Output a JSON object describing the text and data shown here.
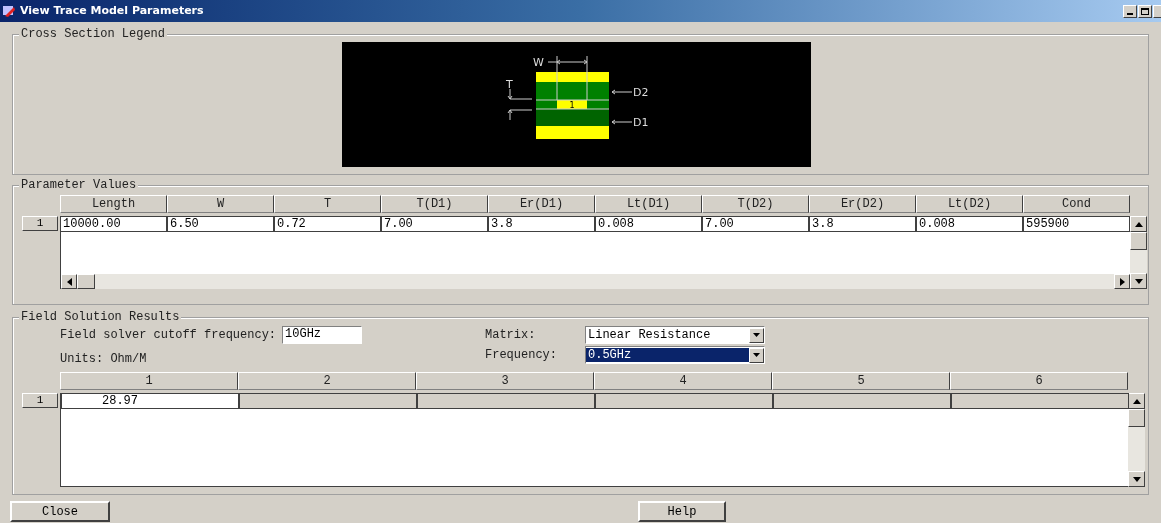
{
  "window": {
    "title": "View Trace Model Parameters"
  },
  "cross_section": {
    "title": "Cross Section Legend",
    "diagram_labels": {
      "width": "W",
      "thickness": "T",
      "upper_dielectric": "D2",
      "lower_dielectric": "D1",
      "trace": "1"
    }
  },
  "parameters": {
    "title": "Parameter Values",
    "columns": [
      "Length",
      "W",
      "T",
      "T(D1)",
      "Er(D1)",
      "Lt(D1)",
      "T(D2)",
      "Er(D2)",
      "Lt(D2)",
      "Cond"
    ],
    "rows": [
      {
        "header": "1",
        "cells": [
          "10000.00",
          "6.50",
          "0.72",
          "7.00",
          "3.8",
          "0.008",
          "7.00",
          "3.8",
          "0.008",
          "595900"
        ]
      }
    ]
  },
  "results": {
    "title": "Field Solution Results",
    "cutoff_label": "Field solver cutoff frequency:",
    "cutoff_value": "10GHz",
    "matrix_label": "Matrix:",
    "matrix_value": "Linear Resistance",
    "frequency_label": "Frequency:",
    "frequency_value": "0.5GHz",
    "units": "Units: Ohm/M",
    "columns": [
      "1",
      "2",
      "3",
      "4",
      "5",
      "6"
    ],
    "rows": [
      {
        "header": "1",
        "cells": [
          "28.97",
          "",
          "",
          "",
          "",
          ""
        ]
      }
    ]
  },
  "buttons": [
    "Close",
    "Help"
  ]
}
